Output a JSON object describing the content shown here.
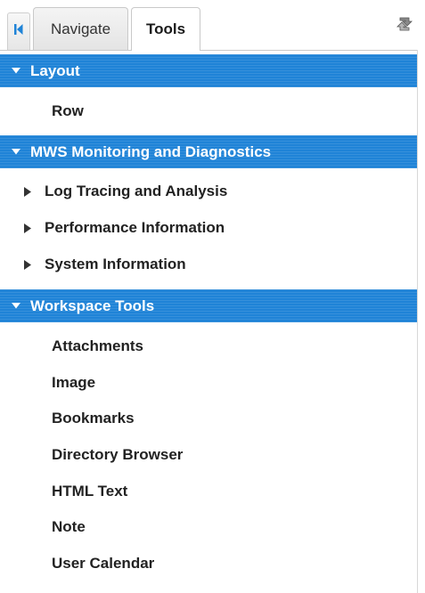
{
  "tabs": {
    "navigate_label": "Navigate",
    "tools_label": "Tools",
    "active": "Tools"
  },
  "colors": {
    "section_header_bg": "#1f83d7",
    "section_header_text": "#ffffff",
    "collapse_arrow": "#1f83d7"
  },
  "icons": {
    "collapse": "collapse-panel-icon",
    "refresh": "refresh-icon",
    "expanded": "triangle-down-icon",
    "collapsed": "triangle-right-icon"
  },
  "sections": [
    {
      "title": "Layout",
      "expanded": true,
      "items": [
        {
          "label": "Row",
          "type": "leaf"
        }
      ]
    },
    {
      "title": "MWS Monitoring and Diagnostics",
      "expanded": true,
      "items": [
        {
          "label": "Log Tracing and Analysis",
          "type": "node",
          "expanded": false
        },
        {
          "label": "Performance Information",
          "type": "node",
          "expanded": false
        },
        {
          "label": "System Information",
          "type": "node",
          "expanded": false
        }
      ]
    },
    {
      "title": "Workspace Tools",
      "expanded": true,
      "items": [
        {
          "label": "Attachments",
          "type": "leaf"
        },
        {
          "label": "Image",
          "type": "leaf"
        },
        {
          "label": "Bookmarks",
          "type": "leaf"
        },
        {
          "label": "Directory Browser",
          "type": "leaf"
        },
        {
          "label": "HTML Text",
          "type": "leaf"
        },
        {
          "label": "Note",
          "type": "leaf"
        },
        {
          "label": "User Calendar",
          "type": "leaf"
        }
      ]
    }
  ]
}
